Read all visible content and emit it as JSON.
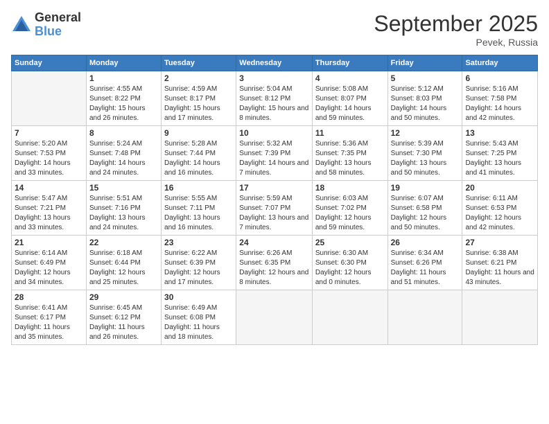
{
  "logo": {
    "general": "General",
    "blue": "Blue"
  },
  "title": "September 2025",
  "location": "Pevek, Russia",
  "days_of_week": [
    "Sunday",
    "Monday",
    "Tuesday",
    "Wednesday",
    "Thursday",
    "Friday",
    "Saturday"
  ],
  "weeks": [
    [
      {
        "day": "",
        "sunrise": "",
        "sunset": "",
        "daylight": ""
      },
      {
        "day": "1",
        "sunrise": "Sunrise: 4:55 AM",
        "sunset": "Sunset: 8:22 PM",
        "daylight": "Daylight: 15 hours and 26 minutes."
      },
      {
        "day": "2",
        "sunrise": "Sunrise: 4:59 AM",
        "sunset": "Sunset: 8:17 PM",
        "daylight": "Daylight: 15 hours and 17 minutes."
      },
      {
        "day": "3",
        "sunrise": "Sunrise: 5:04 AM",
        "sunset": "Sunset: 8:12 PM",
        "daylight": "Daylight: 15 hours and 8 minutes."
      },
      {
        "day": "4",
        "sunrise": "Sunrise: 5:08 AM",
        "sunset": "Sunset: 8:07 PM",
        "daylight": "Daylight: 14 hours and 59 minutes."
      },
      {
        "day": "5",
        "sunrise": "Sunrise: 5:12 AM",
        "sunset": "Sunset: 8:03 PM",
        "daylight": "Daylight: 14 hours and 50 minutes."
      },
      {
        "day": "6",
        "sunrise": "Sunrise: 5:16 AM",
        "sunset": "Sunset: 7:58 PM",
        "daylight": "Daylight: 14 hours and 42 minutes."
      }
    ],
    [
      {
        "day": "7",
        "sunrise": "Sunrise: 5:20 AM",
        "sunset": "Sunset: 7:53 PM",
        "daylight": "Daylight: 14 hours and 33 minutes."
      },
      {
        "day": "8",
        "sunrise": "Sunrise: 5:24 AM",
        "sunset": "Sunset: 7:48 PM",
        "daylight": "Daylight: 14 hours and 24 minutes."
      },
      {
        "day": "9",
        "sunrise": "Sunrise: 5:28 AM",
        "sunset": "Sunset: 7:44 PM",
        "daylight": "Daylight: 14 hours and 16 minutes."
      },
      {
        "day": "10",
        "sunrise": "Sunrise: 5:32 AM",
        "sunset": "Sunset: 7:39 PM",
        "daylight": "Daylight: 14 hours and 7 minutes."
      },
      {
        "day": "11",
        "sunrise": "Sunrise: 5:36 AM",
        "sunset": "Sunset: 7:35 PM",
        "daylight": "Daylight: 13 hours and 58 minutes."
      },
      {
        "day": "12",
        "sunrise": "Sunrise: 5:39 AM",
        "sunset": "Sunset: 7:30 PM",
        "daylight": "Daylight: 13 hours and 50 minutes."
      },
      {
        "day": "13",
        "sunrise": "Sunrise: 5:43 AM",
        "sunset": "Sunset: 7:25 PM",
        "daylight": "Daylight: 13 hours and 41 minutes."
      }
    ],
    [
      {
        "day": "14",
        "sunrise": "Sunrise: 5:47 AM",
        "sunset": "Sunset: 7:21 PM",
        "daylight": "Daylight: 13 hours and 33 minutes."
      },
      {
        "day": "15",
        "sunrise": "Sunrise: 5:51 AM",
        "sunset": "Sunset: 7:16 PM",
        "daylight": "Daylight: 13 hours and 24 minutes."
      },
      {
        "day": "16",
        "sunrise": "Sunrise: 5:55 AM",
        "sunset": "Sunset: 7:11 PM",
        "daylight": "Daylight: 13 hours and 16 minutes."
      },
      {
        "day": "17",
        "sunrise": "Sunrise: 5:59 AM",
        "sunset": "Sunset: 7:07 PM",
        "daylight": "Daylight: 13 hours and 7 minutes."
      },
      {
        "day": "18",
        "sunrise": "Sunrise: 6:03 AM",
        "sunset": "Sunset: 7:02 PM",
        "daylight": "Daylight: 12 hours and 59 minutes."
      },
      {
        "day": "19",
        "sunrise": "Sunrise: 6:07 AM",
        "sunset": "Sunset: 6:58 PM",
        "daylight": "Daylight: 12 hours and 50 minutes."
      },
      {
        "day": "20",
        "sunrise": "Sunrise: 6:11 AM",
        "sunset": "Sunset: 6:53 PM",
        "daylight": "Daylight: 12 hours and 42 minutes."
      }
    ],
    [
      {
        "day": "21",
        "sunrise": "Sunrise: 6:14 AM",
        "sunset": "Sunset: 6:49 PM",
        "daylight": "Daylight: 12 hours and 34 minutes."
      },
      {
        "day": "22",
        "sunrise": "Sunrise: 6:18 AM",
        "sunset": "Sunset: 6:44 PM",
        "daylight": "Daylight: 12 hours and 25 minutes."
      },
      {
        "day": "23",
        "sunrise": "Sunrise: 6:22 AM",
        "sunset": "Sunset: 6:39 PM",
        "daylight": "Daylight: 12 hours and 17 minutes."
      },
      {
        "day": "24",
        "sunrise": "Sunrise: 6:26 AM",
        "sunset": "Sunset: 6:35 PM",
        "daylight": "Daylight: 12 hours and 8 minutes."
      },
      {
        "day": "25",
        "sunrise": "Sunrise: 6:30 AM",
        "sunset": "Sunset: 6:30 PM",
        "daylight": "Daylight: 12 hours and 0 minutes."
      },
      {
        "day": "26",
        "sunrise": "Sunrise: 6:34 AM",
        "sunset": "Sunset: 6:26 PM",
        "daylight": "Daylight: 11 hours and 51 minutes."
      },
      {
        "day": "27",
        "sunrise": "Sunrise: 6:38 AM",
        "sunset": "Sunset: 6:21 PM",
        "daylight": "Daylight: 11 hours and 43 minutes."
      }
    ],
    [
      {
        "day": "28",
        "sunrise": "Sunrise: 6:41 AM",
        "sunset": "Sunset: 6:17 PM",
        "daylight": "Daylight: 11 hours and 35 minutes."
      },
      {
        "day": "29",
        "sunrise": "Sunrise: 6:45 AM",
        "sunset": "Sunset: 6:12 PM",
        "daylight": "Daylight: 11 hours and 26 minutes."
      },
      {
        "day": "30",
        "sunrise": "Sunrise: 6:49 AM",
        "sunset": "Sunset: 6:08 PM",
        "daylight": "Daylight: 11 hours and 18 minutes."
      },
      {
        "day": "",
        "sunrise": "",
        "sunset": "",
        "daylight": ""
      },
      {
        "day": "",
        "sunrise": "",
        "sunset": "",
        "daylight": ""
      },
      {
        "day": "",
        "sunrise": "",
        "sunset": "",
        "daylight": ""
      },
      {
        "day": "",
        "sunrise": "",
        "sunset": "",
        "daylight": ""
      }
    ]
  ]
}
